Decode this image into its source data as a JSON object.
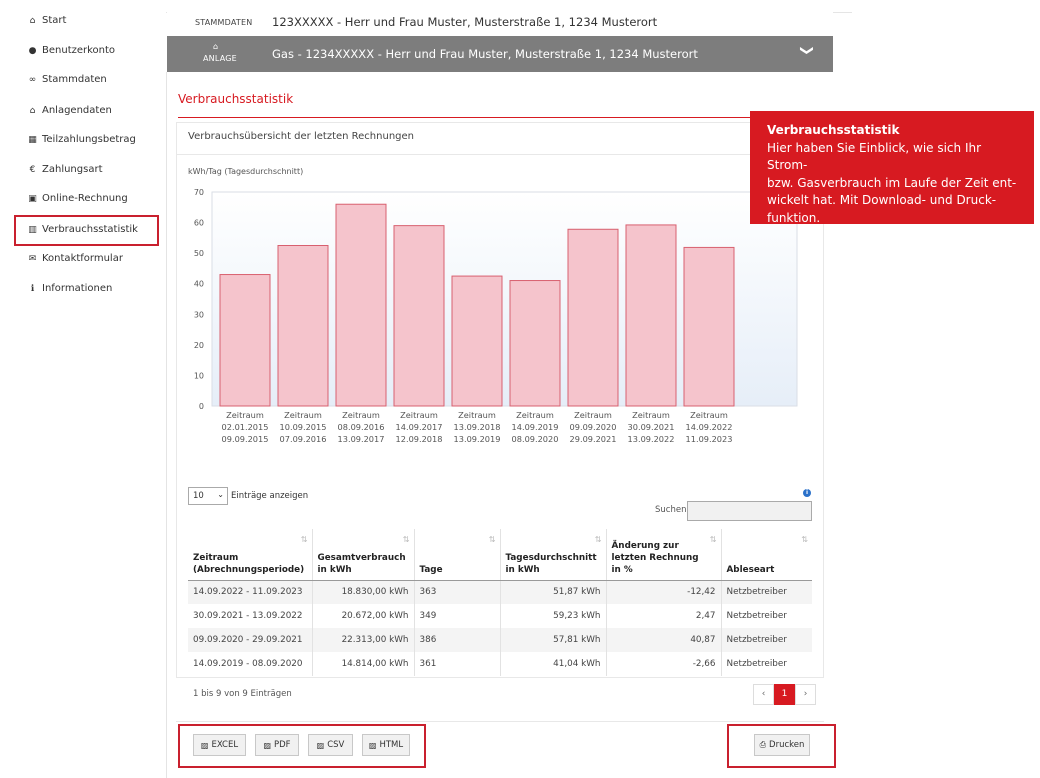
{
  "sidebar": {
    "items": [
      {
        "label": "Start",
        "icon": "home-icon",
        "glyph": "⌂"
      },
      {
        "label": "Benutzerkonto",
        "icon": "user-icon",
        "glyph": "●"
      },
      {
        "label": "Stammdaten",
        "icon": "handshake-icon",
        "glyph": "∞"
      },
      {
        "label": "Anlagendaten",
        "icon": "home-icon",
        "glyph": "⌂"
      },
      {
        "label": "Teilzahlungsbetrag",
        "icon": "calculator-icon",
        "glyph": "▦"
      },
      {
        "label": "Zahlungsart",
        "icon": "euro-icon",
        "glyph": "€"
      },
      {
        "label": "Online-Rechnung",
        "icon": "document-icon",
        "glyph": "▣"
      },
      {
        "label": "Verbrauchsstatistik",
        "icon": "bar-chart-icon",
        "glyph": "▥"
      },
      {
        "label": "Kontaktformular",
        "icon": "envelope-icon",
        "glyph": "✉"
      },
      {
        "label": "Informationen",
        "icon": "info-icon",
        "glyph": "ℹ"
      }
    ]
  },
  "header": {
    "stammdaten_label": "STAMMDATEN",
    "stammdaten_text": "123XXXXX - Herr und Frau Muster, Musterstraße 1, 1234 Musterort",
    "anlage_label": "ANLAGE",
    "anlage_text": "Gas - 1234XXXXX - Herr und Frau Muster, Musterstraße 1, 1234 Musterort",
    "chevron": "❯"
  },
  "section_title": "Verbrauchsstatistik",
  "panel_title": "Verbrauchsübersicht der letzten Rechnungen",
  "chart_data": {
    "type": "bar",
    "ylabel": "kWh/Tag (Tagesdurchschnitt)",
    "ylim": [
      0,
      70
    ],
    "yticks": [
      0,
      10,
      20,
      30,
      40,
      50,
      60,
      70
    ],
    "categories": [
      [
        "Zeitraum",
        "02.01.2015",
        "09.09.2015"
      ],
      [
        "Zeitraum",
        "10.09.2015",
        "07.09.2016"
      ],
      [
        "Zeitraum",
        "08.09.2016",
        "13.09.2017"
      ],
      [
        "Zeitraum",
        "14.09.2017",
        "12.09.2018"
      ],
      [
        "Zeitraum",
        "13.09.2018",
        "13.09.2019"
      ],
      [
        "Zeitraum",
        "14.09.2019",
        "08.09.2020"
      ],
      [
        "Zeitraum",
        "09.09.2020",
        "29.09.2021"
      ],
      [
        "Zeitraum",
        "30.09.2021",
        "13.09.2022"
      ],
      [
        "Zeitraum",
        "14.09.2022",
        "11.09.2023"
      ]
    ],
    "values": [
      43,
      52.5,
      66,
      59,
      42.5,
      41.04,
      57.81,
      59.23,
      51.87
    ],
    "grid": false,
    "bar_color": "#f5c4cc",
    "bar_edge": "#d8606f"
  },
  "tooltip": {
    "title": "Verbrauchsstatistik",
    "lines": [
      "Hier haben Sie Einblick, wie sich Ihr Strom-",
      "bzw. Gasverbrauch im Laufe der Zeit ent-",
      "wickelt hat. Mit Download- und Druck-",
      "funktion."
    ]
  },
  "table_controls": {
    "page_size": "10",
    "entries_label": "Einträge anzeigen",
    "search_label": "Suchen"
  },
  "table": {
    "columns": [
      {
        "l1": "Zeitraum",
        "l2": "(Abrechnungsperiode)"
      },
      {
        "l1": "Gesamtverbrauch",
        "l2": "in kWh"
      },
      {
        "l1": "",
        "l2": "Tage"
      },
      {
        "l1": "Tagesdurchschnitt",
        "l2": "in kWh"
      },
      {
        "l1": "Änderung zur",
        "l1b": "letzten Rechnung",
        "l2": "in %"
      },
      {
        "l1": "",
        "l2": "Ableseart"
      }
    ],
    "rows": [
      [
        "14.09.2022 - 11.09.2023",
        "18.830,00 kWh",
        "363",
        "51,87 kWh",
        "-12,42",
        "Netzbetreiber"
      ],
      [
        "30.09.2021 - 13.09.2022",
        "20.672,00 kWh",
        "349",
        "59,23 kWh",
        "2,47",
        "Netzbetreiber"
      ],
      [
        "09.09.2020 - 29.09.2021",
        "22.313,00 kWh",
        "386",
        "57,81 kWh",
        "40,87",
        "Netzbetreiber"
      ],
      [
        "14.09.2019 - 08.09.2020",
        "14.814,00 kWh",
        "361",
        "41,04 kWh",
        "-2,66",
        "Netzbetreiber"
      ]
    ],
    "info": "1 bis 9 von 9 Einträgen"
  },
  "pager": {
    "prev": "‹",
    "current": "1",
    "next": "›"
  },
  "buttons": {
    "excel": "EXCEL",
    "pdf": "PDF",
    "csv": "CSV",
    "html": "HTML",
    "print": "Drucken"
  }
}
